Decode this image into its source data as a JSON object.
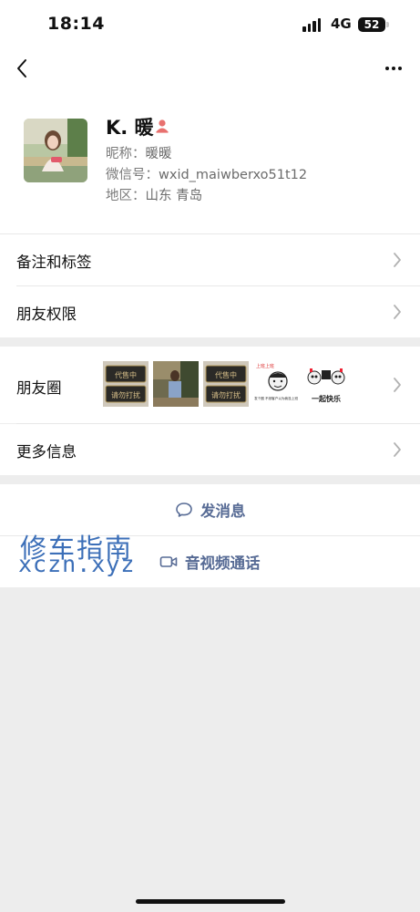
{
  "status_bar": {
    "time": "18:14",
    "network": "4G",
    "battery": "52"
  },
  "profile": {
    "name": "K. 暖",
    "nickname_label": "昵称：",
    "nickname": "暖暖",
    "wechat_id_label": "微信号：",
    "wechat_id": "wxid_maiwberxo51t12",
    "region_label": "地区：",
    "region": "山东 青岛"
  },
  "rows": {
    "remarks_tags": "备注和标签",
    "friend_permissions": "朋友权限",
    "moments": "朋友圈",
    "more_info": "更多信息"
  },
  "moments_thumbs": [
    {
      "alt": "plaque-image",
      "text_top": "代售中",
      "text_bottom": "请勿打扰"
    },
    {
      "alt": "photo-image"
    },
    {
      "alt": "plaque-image",
      "text_top": "代售中",
      "text_bottom": "请勿打扰"
    },
    {
      "alt": "meme-image",
      "text_top": "上班上班",
      "text_bottom": "发个圈 不然客户以为我没上班"
    },
    {
      "alt": "panda-meme-image",
      "text_bottom": "一起快乐"
    }
  ],
  "actions": {
    "send_message": "发消息",
    "video_call": "音视频通话"
  },
  "watermark": {
    "line1": "修车指南",
    "line2": "xczn.xyz"
  },
  "colors": {
    "link": "#576b95",
    "background": "#ededed",
    "gender": "#e8716f"
  }
}
